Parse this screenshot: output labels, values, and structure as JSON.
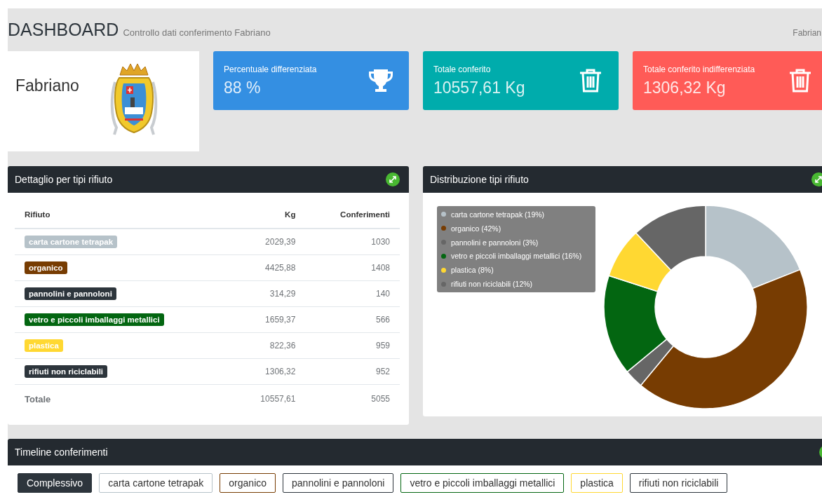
{
  "header": {
    "title": "DASHBOARD",
    "subtitle": "Controllo dati conferimento Fabriano",
    "breadcrumb": "Fabrian"
  },
  "city_card": {
    "name": "Fabriano"
  },
  "stat_cards": [
    {
      "label": "Percentuale differenziata",
      "value": "88 %",
      "kind": "trophy",
      "color": "#348fe2"
    },
    {
      "label": "Totale conferito",
      "value": "10557,61 Kg",
      "kind": "trash",
      "color": "#00acac"
    },
    {
      "label": "Totale conferito indifferenziata",
      "value": "1306,32 Kg",
      "kind": "trash",
      "color": "#ff5b57"
    }
  ],
  "detail_panel": {
    "title": "Dettaglio per tipi rifiuto",
    "columns": [
      "Rifiuto",
      "Kg",
      "Conferimenti"
    ],
    "rows": [
      {
        "label": "carta cartone tetrapak",
        "color": "#b6c2c9",
        "kg": "2029,39",
        "count": "1030"
      },
      {
        "label": "organico",
        "color": "#773c02",
        "kg": "4425,88",
        "count": "1408"
      },
      {
        "label": "pannolini e pannoloni",
        "color": "#2d353c",
        "kg": "314,29",
        "count": "140"
      },
      {
        "label": "vetro e piccoli imballaggi metallici",
        "color": "#036611",
        "kg": "1659,37",
        "count": "566"
      },
      {
        "label": "plastica",
        "color": "#ffd832",
        "kg": "822,36",
        "count": "959"
      },
      {
        "label": "rifiuti non riciclabili",
        "color": "#2d353c",
        "kg": "1306,32",
        "count": "952"
      }
    ],
    "total": {
      "label": "Totale",
      "kg": "10557,61",
      "count": "5055"
    }
  },
  "distribution_panel": {
    "title": "Distribuzione tipi rifiuto",
    "chart_data": {
      "type": "donut",
      "categories": [
        "carta cartone tetrapak (19%)",
        "organico (42%)",
        "pannolini e pannoloni (3%)",
        "vetro e piccoli imballaggi metallici (16%)",
        "plastica (8%)",
        "rifiuti non riciclabili (12%)"
      ],
      "values": [
        19,
        42,
        3,
        16,
        8,
        12
      ],
      "legend": "left",
      "colors": [
        "#b6c2c9",
        "#773c02",
        "#666666",
        "#036611",
        "#ffd832",
        "#666666"
      ]
    }
  },
  "timeline_panel": {
    "title": "Timeline conferimenti",
    "filters": [
      {
        "label": "Complessivo",
        "color": "#2d353c",
        "selected": true
      },
      {
        "label": "carta cartone tetrapak",
        "color": "#b6c2c9",
        "selected": false
      },
      {
        "label": "organico",
        "color": "#773c02",
        "selected": false
      },
      {
        "label": "pannolini e pannoloni",
        "color": "#2d353c",
        "selected": false
      },
      {
        "label": "vetro e piccoli imballaggi metallici",
        "color": "#036611",
        "selected": false
      },
      {
        "label": "plastica",
        "color": "#ffd832",
        "selected": false
      },
      {
        "label": "rifiuti non riciclabili",
        "color": "#2d353c",
        "selected": false
      }
    ]
  }
}
